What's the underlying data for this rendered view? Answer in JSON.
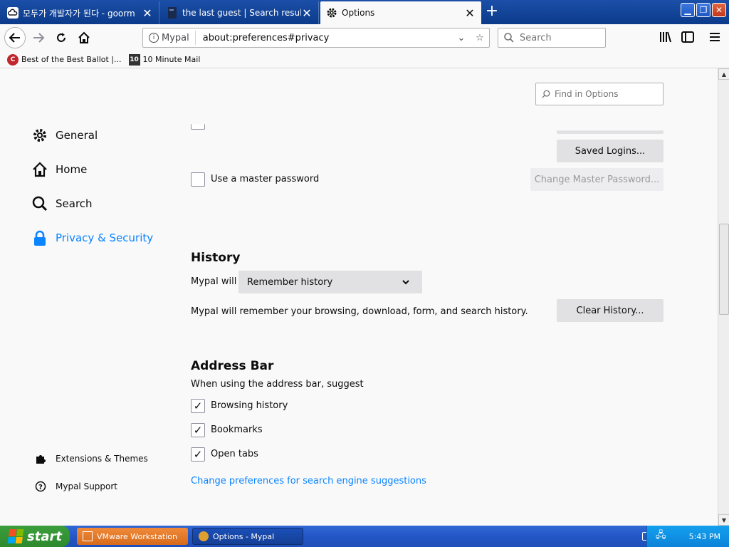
{
  "tabs": [
    {
      "title": "모두가 개발자가 된다 - goorm",
      "icon": "goorm-cloud-icon"
    },
    {
      "title": "the last guest | Search results | We",
      "icon": "book-icon"
    },
    {
      "title": "Options",
      "icon": "gear-icon"
    }
  ],
  "navbar": {
    "identity_label": "Mypal",
    "url": "about:preferences#privacy",
    "search_placeholder": "Search"
  },
  "bookmarks": [
    {
      "label": "Best of the Best Ballot |...",
      "icon_text": "C"
    },
    {
      "label": "10 Minute Mail",
      "icon_text": "10"
    }
  ],
  "find": {
    "placeholder": "Find in Options"
  },
  "sidebar": {
    "categories": [
      {
        "label": "General",
        "icon": "gear-icon"
      },
      {
        "label": "Home",
        "icon": "home-icon"
      },
      {
        "label": "Search",
        "icon": "search-icon"
      },
      {
        "label": "Privacy & Security",
        "icon": "lock-icon",
        "selected": true
      }
    ],
    "footer": [
      {
        "label": "Extensions & Themes",
        "icon": "puzzle-icon"
      },
      {
        "label": "Mypal Support",
        "icon": "help-icon"
      }
    ]
  },
  "logins": {
    "saved_logins_button": "Saved Logins...",
    "master_password_label": "Use a master password",
    "master_password_checked": false,
    "change_master_button": "Change Master Password..."
  },
  "history": {
    "heading": "History",
    "mypal_will_label": "Mypal will",
    "mode_selected": "Remember history",
    "description": "Mypal will remember your browsing, download, form, and search history.",
    "clear_button": "Clear History..."
  },
  "address_bar": {
    "heading": "Address Bar",
    "subheading": "When using the address bar, suggest",
    "options": [
      {
        "label": "Browsing history",
        "checked": true
      },
      {
        "label": "Bookmarks",
        "checked": true
      },
      {
        "label": "Open tabs",
        "checked": true
      }
    ],
    "change_link": "Change preferences for search engine suggestions"
  },
  "taskbar": {
    "start_label": "start",
    "tasks": [
      {
        "label": "VMware Workstation",
        "icon": "vmware-icon"
      },
      {
        "label": "Options - Mypal",
        "icon": "mypal-icon"
      }
    ],
    "clock": "5:43 PM"
  },
  "colors": {
    "accent": "#0a84ff",
    "tabbar": "#0b3a8a",
    "content_bg": "#f9f9fa"
  }
}
